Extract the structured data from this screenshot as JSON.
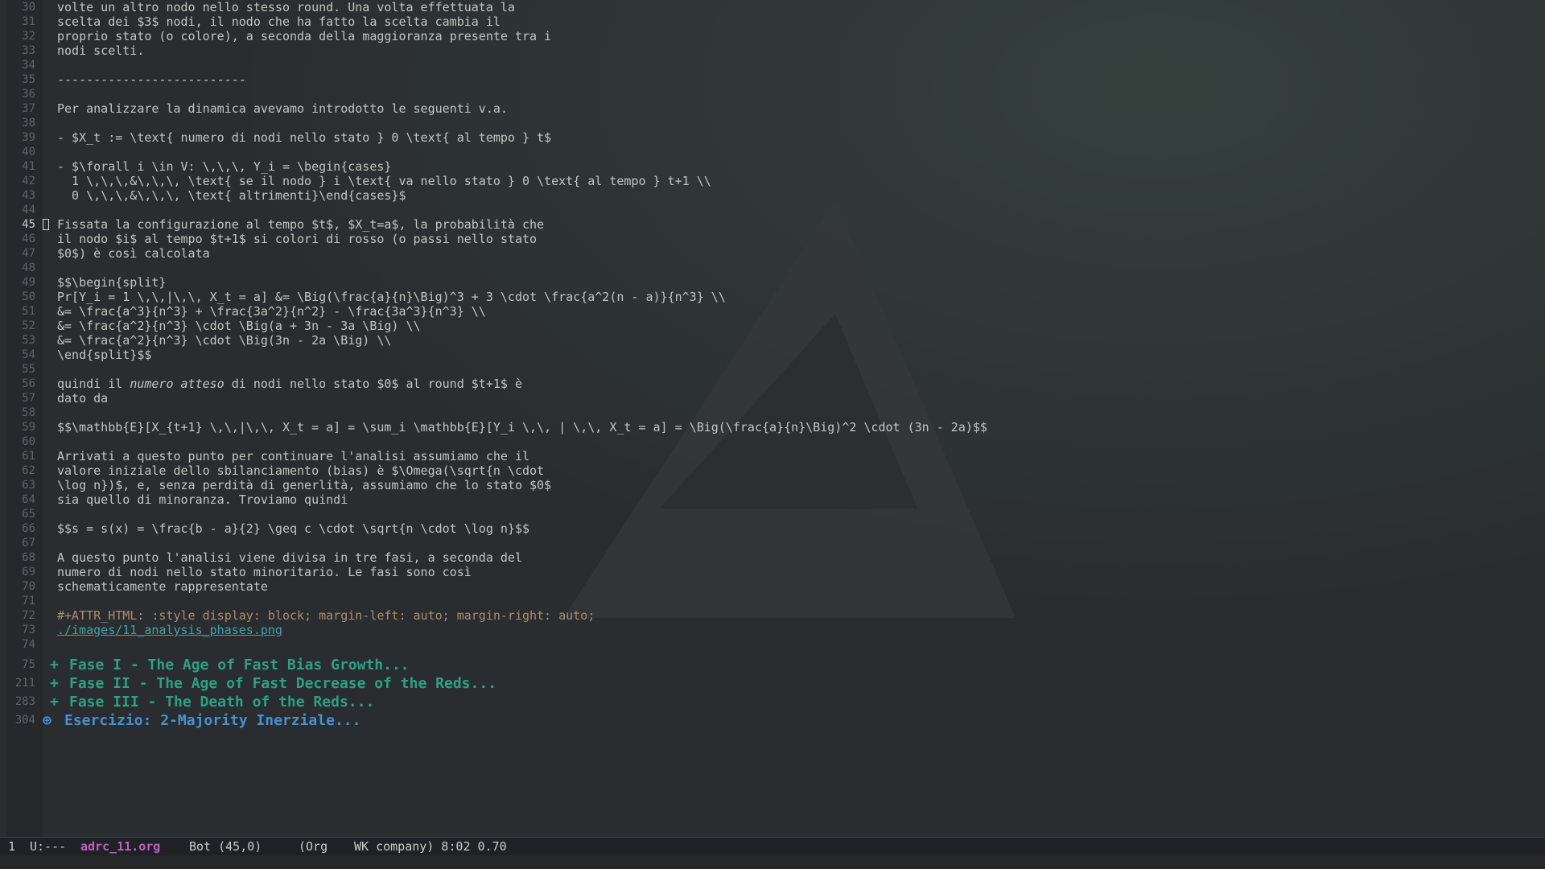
{
  "theme": {
    "background": "#2a2d30",
    "text": "#c2c6c2",
    "line_number": "#5f6469",
    "org_meta": "#a98f6a",
    "link": "#3fa3a6",
    "heading_level2": "#2fa082",
    "heading_level1": "#4a8fd1",
    "buffer_name": "#c25fc4"
  },
  "editor": {
    "current_line": "45",
    "lines": [
      {
        "num": "30",
        "text": "volte un altro nodo nello stesso round. Una volta effettuata la"
      },
      {
        "num": "31",
        "text": "scelta dei $3$ nodi, il nodo che ha fatto la scelta cambia il"
      },
      {
        "num": "32",
        "text": "proprio stato (o colore), a seconda della maggioranza presente tra i"
      },
      {
        "num": "33",
        "text": "nodi scelti."
      },
      {
        "num": "34",
        "text": ""
      },
      {
        "num": "35",
        "text": "--------------------------"
      },
      {
        "num": "36",
        "text": ""
      },
      {
        "num": "37",
        "text": "Per analizzare la dinamica avevamo introdotto le seguenti v.a."
      },
      {
        "num": "38",
        "text": ""
      },
      {
        "num": "39",
        "text": "- $X_t := \\text{ numero di nodi nello stato } 0 \\text{ al tempo } t$"
      },
      {
        "num": "40",
        "text": ""
      },
      {
        "num": "41",
        "text": "- $\\forall i \\in V: \\,\\,\\, Y_i = \\begin{cases}"
      },
      {
        "num": "42",
        "text": "  1 \\,\\,\\,&\\,\\,\\, \\text{ se il nodo } i \\text{ va nello stato } 0 \\text{ al tempo } t+1 \\\\"
      },
      {
        "num": "43",
        "text": "  0 \\,\\,\\,&\\,\\,\\, \\text{ altrimenti}\\end{cases}$"
      },
      {
        "num": "44",
        "text": ""
      },
      {
        "num": "45",
        "text": "Fissata la configurazione al tempo $t$, $X_t=a$, la probabilità che"
      },
      {
        "num": "46",
        "text": "il nodo $i$ al tempo $t+1$ si colori di rosso (o passi nello stato"
      },
      {
        "num": "47",
        "text": "$0$) è così calcolata"
      },
      {
        "num": "48",
        "text": ""
      },
      {
        "num": "49",
        "text": "$$\\begin{split}"
      },
      {
        "num": "50",
        "text": "Pr[Y_i = 1 \\,\\,|\\,\\, X_t = a] &= \\Big(\\frac{a}{n}\\Big)^3 + 3 \\cdot \\frac{a^2(n - a)}{n^3} \\\\"
      },
      {
        "num": "51",
        "text": "&= \\frac{a^3}{n^3} + \\frac{3a^2}{n^2} - \\frac{3a^3}{n^3} \\\\"
      },
      {
        "num": "52",
        "text": "&= \\frac{a^2}{n^3} \\cdot \\Big(a + 3n - 3a \\Big) \\\\"
      },
      {
        "num": "53",
        "text": "&= \\frac{a^2}{n^3} \\cdot \\Big(3n - 2a \\Big) \\\\"
      },
      {
        "num": "54",
        "text": "\\end{split}$$"
      },
      {
        "num": "55",
        "text": ""
      },
      {
        "num": "56",
        "pre": "quindi il ",
        "em": "numero atteso",
        "post": " di nodi nello stato $0$ al round $t+1$ è"
      },
      {
        "num": "57",
        "text": "dato da"
      },
      {
        "num": "58",
        "text": ""
      },
      {
        "num": "59",
        "text": "$$\\mathbb{E}[X_{t+1} \\,\\,|\\,\\, X_t = a] = \\sum_i \\mathbb{E}[Y_i \\,\\, | \\,\\, X_t = a] = \\Big(\\frac{a}{n}\\Big)^2 \\cdot (3n - 2a)$$"
      },
      {
        "num": "60",
        "text": ""
      },
      {
        "num": "61",
        "text": "Arrivati a questo punto per continuare l'analisi assumiamo che il"
      },
      {
        "num": "62",
        "text": "valore iniziale dello sbilanciamento (bias) è $\\Omega(\\sqrt{n \\cdot"
      },
      {
        "num": "63",
        "text": "\\log n})$, e, senza perdità di generlità, assumiamo che lo stato $0$"
      },
      {
        "num": "64",
        "text": "sia quello di minoranza. Troviamo quindi"
      },
      {
        "num": "65",
        "text": ""
      },
      {
        "num": "66",
        "text": "$$s = s(x) = \\frac{b - a}{2} \\geq c \\cdot \\sqrt{n \\cdot \\log n}$$"
      },
      {
        "num": "67",
        "text": ""
      },
      {
        "num": "68",
        "text": "A questo punto l'analisi viene divisa in tre fasi, a seconda del"
      },
      {
        "num": "69",
        "text": "numero di nodi nello stato minoritario. Le fasi sono così"
      },
      {
        "num": "70",
        "text": "schematicamente rappresentate"
      },
      {
        "num": "71",
        "text": ""
      },
      {
        "num": "72",
        "text": "#+ATTR_HTML: :style display: block; margin-left: auto; margin-right: auto;",
        "style": "meta"
      },
      {
        "num": "73",
        "text": "./images/11_analysis_phases.png",
        "style": "link"
      },
      {
        "num": "74",
        "text": ""
      }
    ],
    "headings": [
      {
        "num": "75",
        "bullet": "+",
        "text": "Fase I - The Age of Fast Bias Growth...",
        "level": 2
      },
      {
        "num": "211",
        "bullet": "+",
        "text": "Fase II - The Age of Fast Decrease of the Reds...",
        "level": 2
      },
      {
        "num": "283",
        "bullet": "+",
        "text": "Fase III - The Death of the Reds...",
        "level": 2
      },
      {
        "num": "304",
        "bullet": "⊕",
        "text": "Esercizio: 2-Majority Inerziale...",
        "level": 1
      }
    ]
  },
  "modeline": {
    "window": "1",
    "state": "U:---",
    "buffer": "adrc_11.org",
    "position": "Bot (45,0)",
    "mode_open": "(Org",
    "icon": "shield-icon",
    "minor": "WK company) 8:02 0.70"
  }
}
